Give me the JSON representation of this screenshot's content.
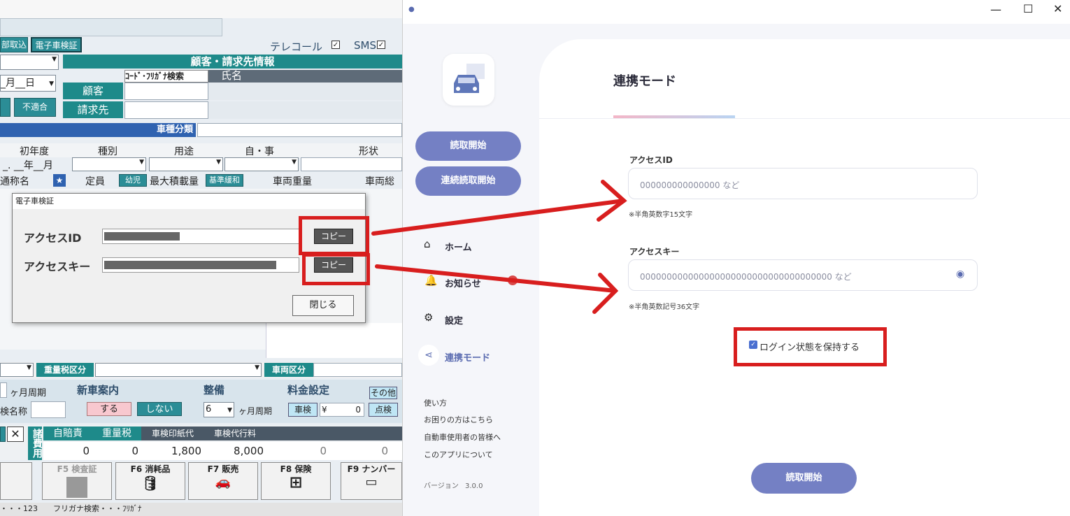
{
  "legacy": {
    "top_buttons": [
      "部取込",
      "電子車検証"
    ],
    "telecall_label": "テレコール",
    "sms_label": "SMS",
    "date_text": "_月__日",
    "customer_header": "顧客・請求先情報",
    "code_search_header": "ｺｰﾄﾞ･ﾌﾘｶﾞﾅ検索",
    "name_header": "氏名",
    "customer_label": "顧客",
    "billing_label": "請求先",
    "nonconform_label": "不適合",
    "vehicle_type_header": "車種分類",
    "columns": [
      "初年度",
      "種別",
      "用途",
      "自・事",
      "形状"
    ],
    "year_month_text": "_. __年__月",
    "row2": [
      "通称名",
      "定員",
      "幼児",
      "最大積載量",
      "基準緩和",
      "車両重量",
      "車両総重"
    ],
    "tonnage_tax_label": "重量税区分",
    "vehicle_class_label": "車両区分",
    "month_cycle_label": "ヶ月周期",
    "class_name_label": "検名称",
    "new_car_label": "新車案内",
    "do_label": "する",
    "dont_label": "しない",
    "maintenance_label": "整備",
    "maintenance_value": "6",
    "fee_label": "料金設定",
    "other_label": "その他",
    "inspection_label": "車検",
    "yen_sign": "¥",
    "fee_value": "0",
    "check_label": "点検",
    "misc_cost_label": "諸費用",
    "cost_headers": [
      "自賠責",
      "重量税",
      "車検印紙代",
      "車検代行料"
    ],
    "cost_values": [
      "0",
      "0",
      "1,800",
      "8,000",
      "0",
      "0"
    ],
    "fkeys": [
      "F5 検査証",
      "F6 消耗品",
      "F7 販売",
      "F8 保険",
      "F9 ナンバー"
    ],
    "status_text": "・・・123　　フリガナ検索・・・ﾌﾘｶﾞﾅ"
  },
  "dialog": {
    "title": "電子車検証",
    "access_id_label": "アクセスID",
    "access_key_label": "アクセスキー",
    "copy_label": "コピー",
    "close_label": "閉じる"
  },
  "app": {
    "page_title": "連携モード",
    "buttons": {
      "read_start": "読取開始",
      "continuous_read": "連続読取開始"
    },
    "nav": {
      "home": "ホーム",
      "news": "お知らせ",
      "settings": "設定",
      "link_mode": "連携モード"
    },
    "links": [
      "使い方",
      "お困りの方はこちら",
      "自動車使用者の皆様へ",
      "このアプリについて"
    ],
    "version_label": "バージョン",
    "version_value": "3.0.0",
    "access_id_label": "アクセスID",
    "access_id_placeholder": "000000000000000 など",
    "access_id_hint": "※半角英数字15文字",
    "access_key_label": "アクセスキー",
    "access_key_placeholder": "000000000000000000000000000000000000 など",
    "access_key_hint": "※半角英数記号36文字",
    "keep_login_label": "ログイン状態を保持する",
    "bottom_button": "読取開始"
  },
  "colors": {
    "annotation_red": "#d81e1e",
    "app_accent": "#7480c4",
    "legacy_teal": "#1e8a8a",
    "legacy_blue": "#2f62b0"
  }
}
